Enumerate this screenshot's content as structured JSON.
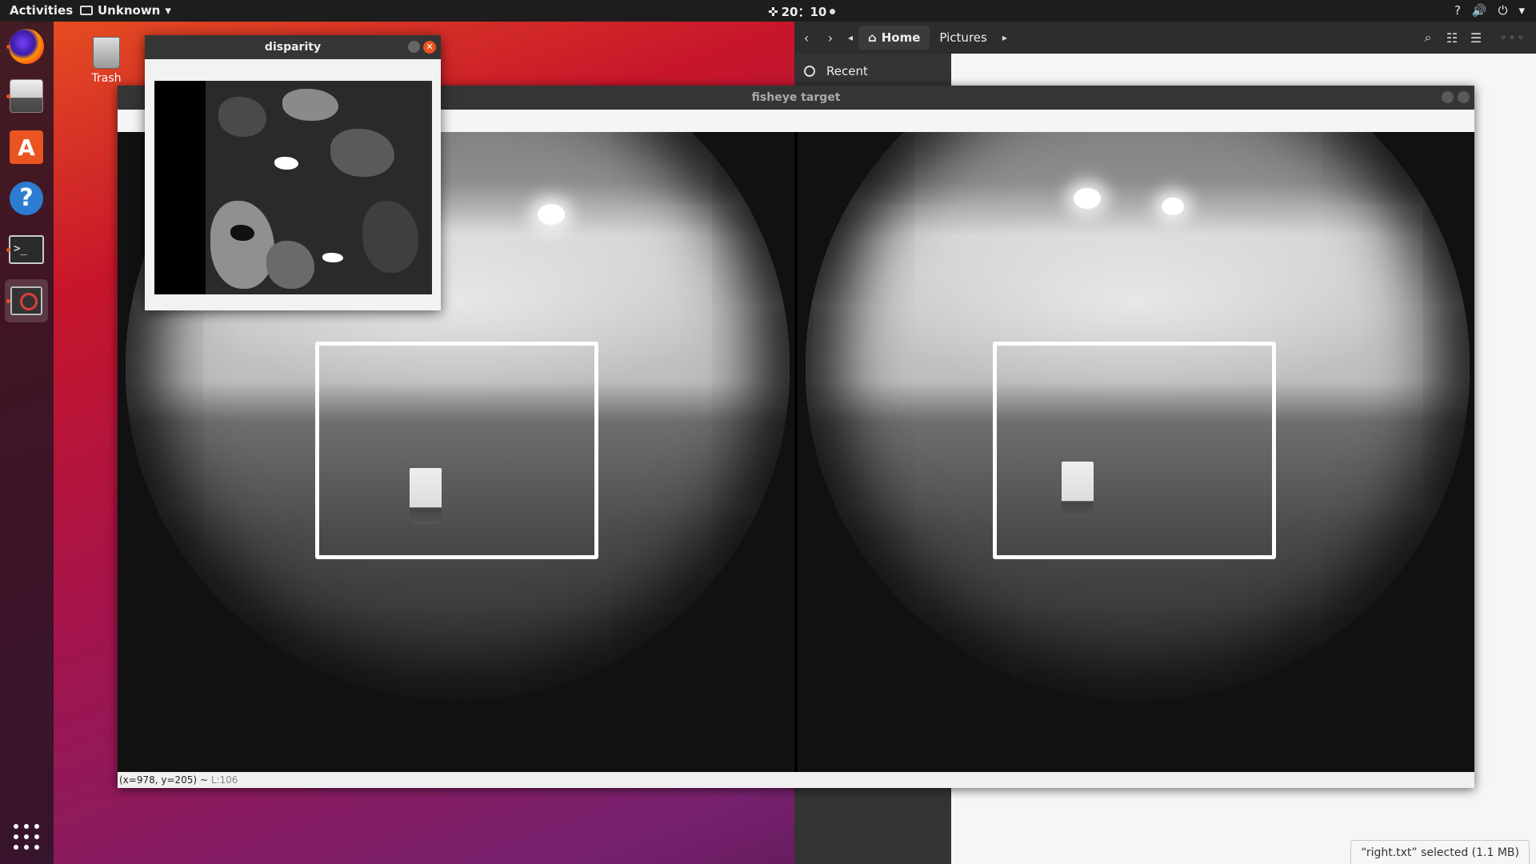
{
  "topbar": {
    "activities": "Activities",
    "app_name": "Unknown",
    "clock": "20：10",
    "tray_icons": [
      "help-icon",
      "volume-icon",
      "power-icon"
    ]
  },
  "dock": {
    "items": [
      "firefox-icon",
      "files-icon",
      "software-icon",
      "help-icon",
      "terminal-icon",
      "blocked-app-icon"
    ],
    "show_apps": "apps-grid-icon"
  },
  "desktop": {
    "trash_label": "Trash"
  },
  "file_manager": {
    "path": [
      "Home",
      "Pictures"
    ],
    "sidebar": [
      "Recent"
    ],
    "status": "“right.txt” selected  (1.1 MB)"
  },
  "disparity_window": {
    "title": "disparity"
  },
  "fisheye_window": {
    "title": "fisheye target",
    "status_coords": "(x=978, y=205) ~",
    "status_level": "L:106"
  },
  "colors": {
    "ubuntu_orange": "#e95420",
    "dark_bar": "#1d1d1d",
    "roi_box": "#ffffff"
  }
}
